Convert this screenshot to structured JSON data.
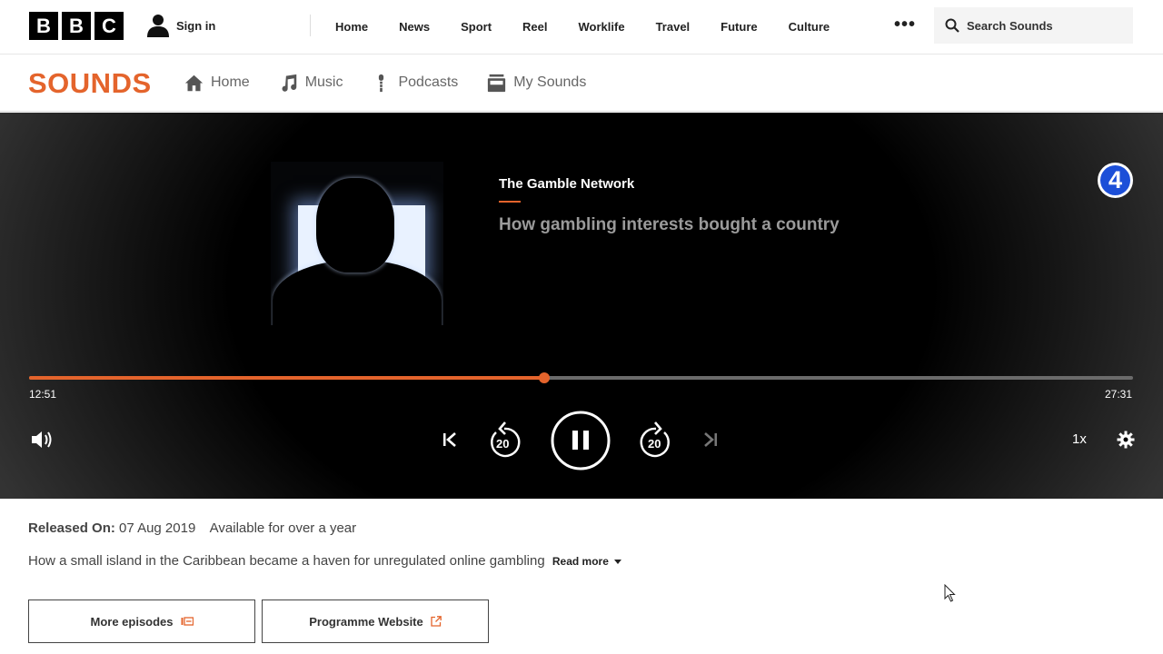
{
  "bbc": {
    "logo_letters": [
      "B",
      "B",
      "C"
    ],
    "sign_in_label": "Sign in",
    "nav": [
      "Home",
      "News",
      "Sport",
      "Reel",
      "Worklife",
      "Travel",
      "Future",
      "Culture"
    ],
    "more_label": "•••",
    "search_placeholder": "Search Sounds"
  },
  "sounds": {
    "logo": "SOUNDS",
    "nav": [
      {
        "label": "Home",
        "icon": "home-icon"
      },
      {
        "label": "Music",
        "icon": "music-note-icon"
      },
      {
        "label": "Podcasts",
        "icon": "podcast-icon"
      },
      {
        "label": "My Sounds",
        "icon": "radio-icon"
      }
    ]
  },
  "player": {
    "programme_title": "The Gamble Network",
    "episode_title": "How gambling interests bought a country",
    "network_badge": "4",
    "elapsed": "12:51",
    "duration": "27:31",
    "progress_fraction": 0.467,
    "rewind_seconds": "20",
    "forward_seconds": "20",
    "speed": "1x",
    "accent_color": "#e4642c"
  },
  "details": {
    "released_label": "Released On:",
    "released_date": "07 Aug 2019",
    "availability": "Available for over a year",
    "synopsis": "How a small island in the Caribbean became a haven for unregulated online gambling",
    "read_more": "Read more",
    "more_episodes_label": "More episodes",
    "programme_website_label": "Programme Website"
  }
}
